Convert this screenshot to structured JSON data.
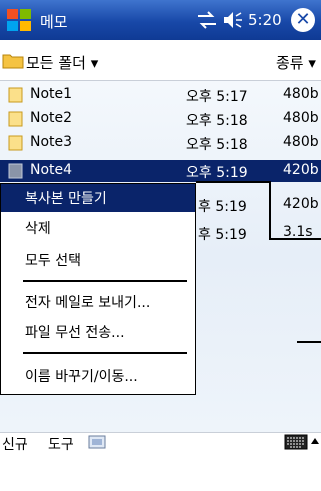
{
  "titlebar": {
    "title": "메모",
    "time": "5:20"
  },
  "folderbar": {
    "folder": "모든 폴더 ▾",
    "sort": "종류 ▾"
  },
  "notes": [
    {
      "name": "Note1",
      "time": "오후 5:17",
      "size": "480b",
      "selected": false
    },
    {
      "name": "Note2",
      "time": "오후 5:18",
      "size": "480b",
      "selected": false
    },
    {
      "name": "Note3",
      "time": "오후 5:18",
      "size": "480b",
      "selected": false
    },
    {
      "name": "Note4",
      "time": "오후 5:19",
      "size": "420b",
      "selected": true
    },
    {
      "name": "",
      "time": "후 5:19",
      "size": "420b",
      "selected": false
    },
    {
      "name": "",
      "time": "후 5:19",
      "size": "3.1s",
      "selected": false
    }
  ],
  "menu": {
    "copy": "복사본 만들기",
    "delete": "삭제",
    "select_all": "모두 선택",
    "email": "전자 메일로 보내기...",
    "beam": "파일 무선 전송...",
    "rename": "이름 바꾸기/이동..."
  },
  "bottombar": {
    "new": "신규",
    "tools": "도구"
  },
  "icons": {
    "start": "windows-flag-icon",
    "connectivity": "connectivity-icon",
    "volume": "volume-icon",
    "close": "close-icon",
    "folder": "folder-icon",
    "note": "note-icon",
    "keyboard": "keyboard-icon",
    "up_arrow": "up-arrow-icon"
  },
  "colors": {
    "title_bar": "#1848a8",
    "selection": "#0a246a"
  }
}
